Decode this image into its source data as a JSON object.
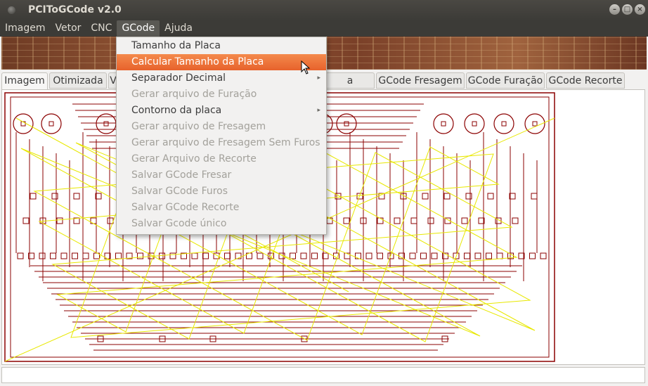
{
  "window": {
    "title": "PCIToGCode  v2.0"
  },
  "menubar": [
    "Imagem",
    "Vetor",
    "CNC",
    "GCode",
    "Ajuda"
  ],
  "tabs": [
    "Imagem",
    "Otimizada",
    "V",
    "a Furaçao",
    "GCode Fresagem",
    "GCode Furação",
    "GCode Recorte"
  ],
  "gcode_menu": {
    "items": [
      {
        "label": "Tamanho da Placa",
        "enabled": true
      },
      {
        "label": "Calcular Tamanho da Placa",
        "enabled": true,
        "highlighted": true
      },
      {
        "label": "Separador Decimal",
        "enabled": true,
        "submenu": true
      },
      {
        "label": "Gerar arquivo de Furação",
        "enabled": false
      },
      {
        "label": "Contorno da placa",
        "enabled": true,
        "submenu": true
      },
      {
        "label": "Gerar arquivo de Fresagem",
        "enabled": false
      },
      {
        "label": "Gerar arquivo de Fresagem Sem Furos",
        "enabled": false
      },
      {
        "label": "Gerar Arquivo de Recorte",
        "enabled": false
      },
      {
        "label": "Salvar GCode Fresar",
        "enabled": false
      },
      {
        "label": "Salvar GCode Furos",
        "enabled": false
      },
      {
        "label": "Salvar GCode Recorte",
        "enabled": false
      },
      {
        "label": "Salvar Gcode único",
        "enabled": false
      }
    ]
  },
  "colors": {
    "highlight": "#f07746",
    "trace": "#8b0000",
    "drill_path": "#e8e800",
    "titlebar": "#3c3b37"
  }
}
